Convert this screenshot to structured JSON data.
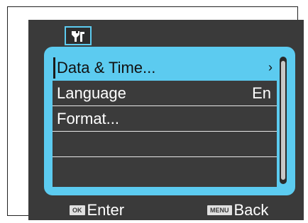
{
  "header": {
    "tab_icon": "wrench-settings-icon"
  },
  "menu": {
    "items": [
      {
        "label": "Data & Time...",
        "value": "",
        "chevron": "›",
        "selected": true
      },
      {
        "label": "Language",
        "value": "En",
        "chevron": "",
        "selected": false
      },
      {
        "label": "Format...",
        "value": "",
        "chevron": "",
        "selected": false
      },
      {
        "label": "",
        "value": "",
        "chevron": "",
        "selected": false
      },
      {
        "label": "",
        "value": "",
        "chevron": "",
        "selected": false
      }
    ]
  },
  "softkeys": {
    "enter": {
      "badge": "OK",
      "label": "Enter"
    },
    "back": {
      "badge": "MENU",
      "label": "Back"
    }
  },
  "colors": {
    "accent": "#5ccbf0",
    "screen_bg": "#3a3a3a",
    "text": "#ffffff"
  }
}
